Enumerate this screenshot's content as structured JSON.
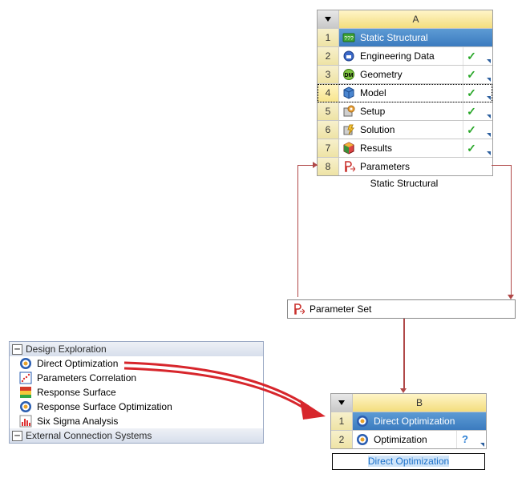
{
  "systemA": {
    "columnHeader": "A",
    "caption": "Static Structural",
    "rows": [
      {
        "num": "1",
        "label": "Static Structural",
        "selected": true,
        "status": "",
        "tri": false
      },
      {
        "num": "2",
        "label": "Engineering Data",
        "status": "check",
        "tri": true
      },
      {
        "num": "3",
        "label": "Geometry",
        "status": "check",
        "tri": true
      },
      {
        "num": "4",
        "label": "Model",
        "status": "check",
        "tri": true,
        "dotted": true
      },
      {
        "num": "5",
        "label": "Setup",
        "status": "check",
        "tri": true
      },
      {
        "num": "6",
        "label": "Solution",
        "status": "check",
        "tri": true
      },
      {
        "num": "7",
        "label": "Results",
        "status": "check",
        "tri": true
      },
      {
        "num": "8",
        "label": "Parameters",
        "status": "",
        "tri": false
      }
    ]
  },
  "parameterSet": {
    "label": "Parameter Set"
  },
  "toolbox": {
    "header1": "Design Exploration",
    "items": [
      "Direct Optimization",
      "Parameters Correlation",
      "Response Surface",
      "Response Surface Optimization",
      "Six Sigma Analysis"
    ],
    "header2": "External Connection Systems"
  },
  "systemB": {
    "columnHeader": "B",
    "rows": [
      {
        "num": "1",
        "label": "Direct Optimization",
        "selected": true,
        "status": "",
        "tri": false
      },
      {
        "num": "2",
        "label": "Optimization",
        "status": "question",
        "tri": true
      }
    ],
    "editLabel": "Direct Optimization"
  }
}
